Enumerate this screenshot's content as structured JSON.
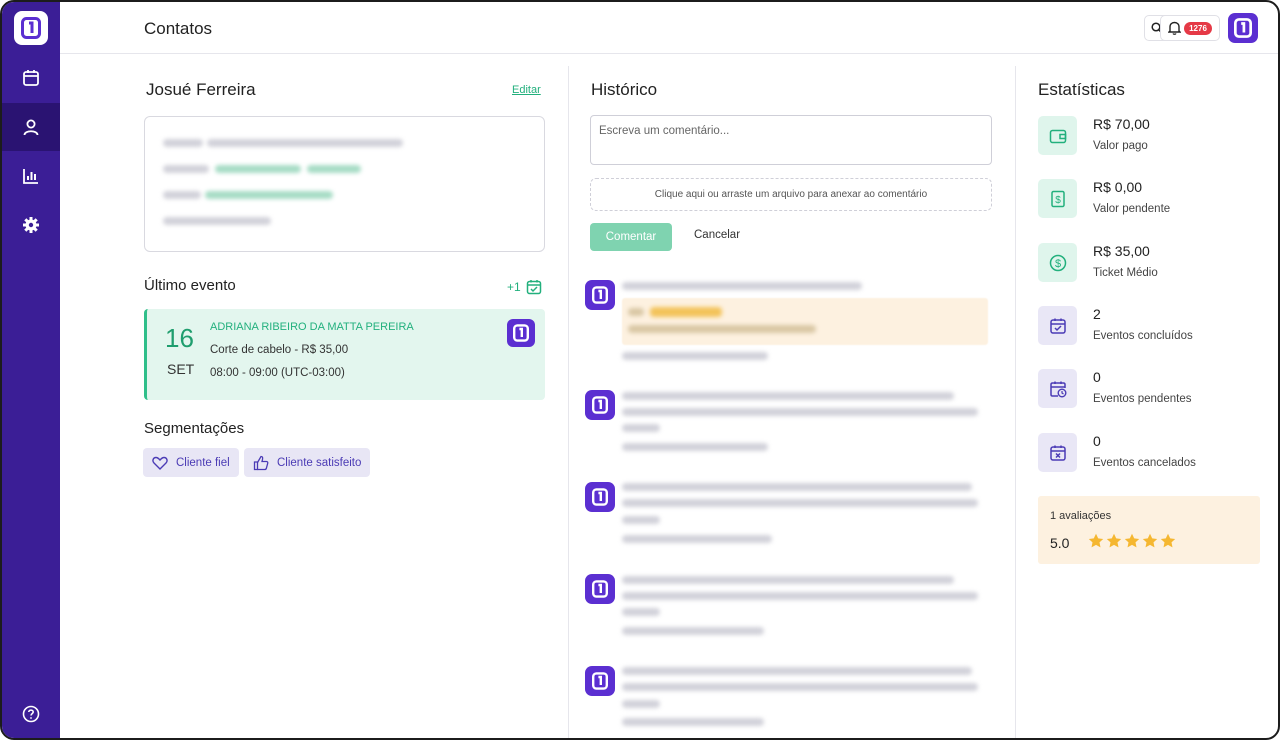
{
  "page": {
    "title": "Contatos"
  },
  "topbar": {
    "notification_count": "1276"
  },
  "contact": {
    "name": "Josué Ferreira",
    "edit_label": "Editar"
  },
  "last_event": {
    "heading": "Último evento",
    "more": "+1",
    "day": "16",
    "month": "SET",
    "professional": "ADRIANA RIBEIRO DA MATTA PEREIRA",
    "service": "Corte de cabelo - R$ 35,00",
    "time": "08:00 - 09:00 (UTC-03:00)"
  },
  "segmentations": {
    "heading": "Segmentações",
    "chips": [
      {
        "label": "Cliente fiel",
        "icon": "heart-icon"
      },
      {
        "label": "Cliente satisfeito",
        "icon": "thumbs-up-icon"
      }
    ]
  },
  "history": {
    "heading": "Histórico",
    "comment_placeholder": "Escreva um comentário...",
    "attach_text": "Clique aqui ou arraste um arquivo para anexar ao comentário",
    "comment_button": "Comentar",
    "cancel_button": "Cancelar"
  },
  "stats": {
    "heading": "Estatísticas",
    "items": [
      {
        "value": "R$ 70,00",
        "label": "Valor pago",
        "icon": "wallet-icon",
        "color": "green"
      },
      {
        "value": "R$ 0,00",
        "label": "Valor pendente",
        "icon": "bill-icon",
        "color": "green"
      },
      {
        "value": "R$ 35,00",
        "label": "Ticket Médio",
        "icon": "dollar-circle-icon",
        "color": "green"
      },
      {
        "value": "2",
        "label": "Eventos concluídos",
        "icon": "calendar-check-icon",
        "color": "purple"
      },
      {
        "value": "0",
        "label": "Eventos pendentes",
        "icon": "calendar-clock-icon",
        "color": "purple"
      },
      {
        "value": "0",
        "label": "Eventos cancelados",
        "icon": "calendar-x-icon",
        "color": "purple"
      }
    ],
    "reviews_count": "1 avaliações",
    "reviews_score": "5.0",
    "reviews_stars": 5
  },
  "colors": {
    "sidebar": "#3b1e96",
    "brand": "#5b2fd1",
    "accent_green": "#22b07d",
    "star": "#f5b731"
  }
}
